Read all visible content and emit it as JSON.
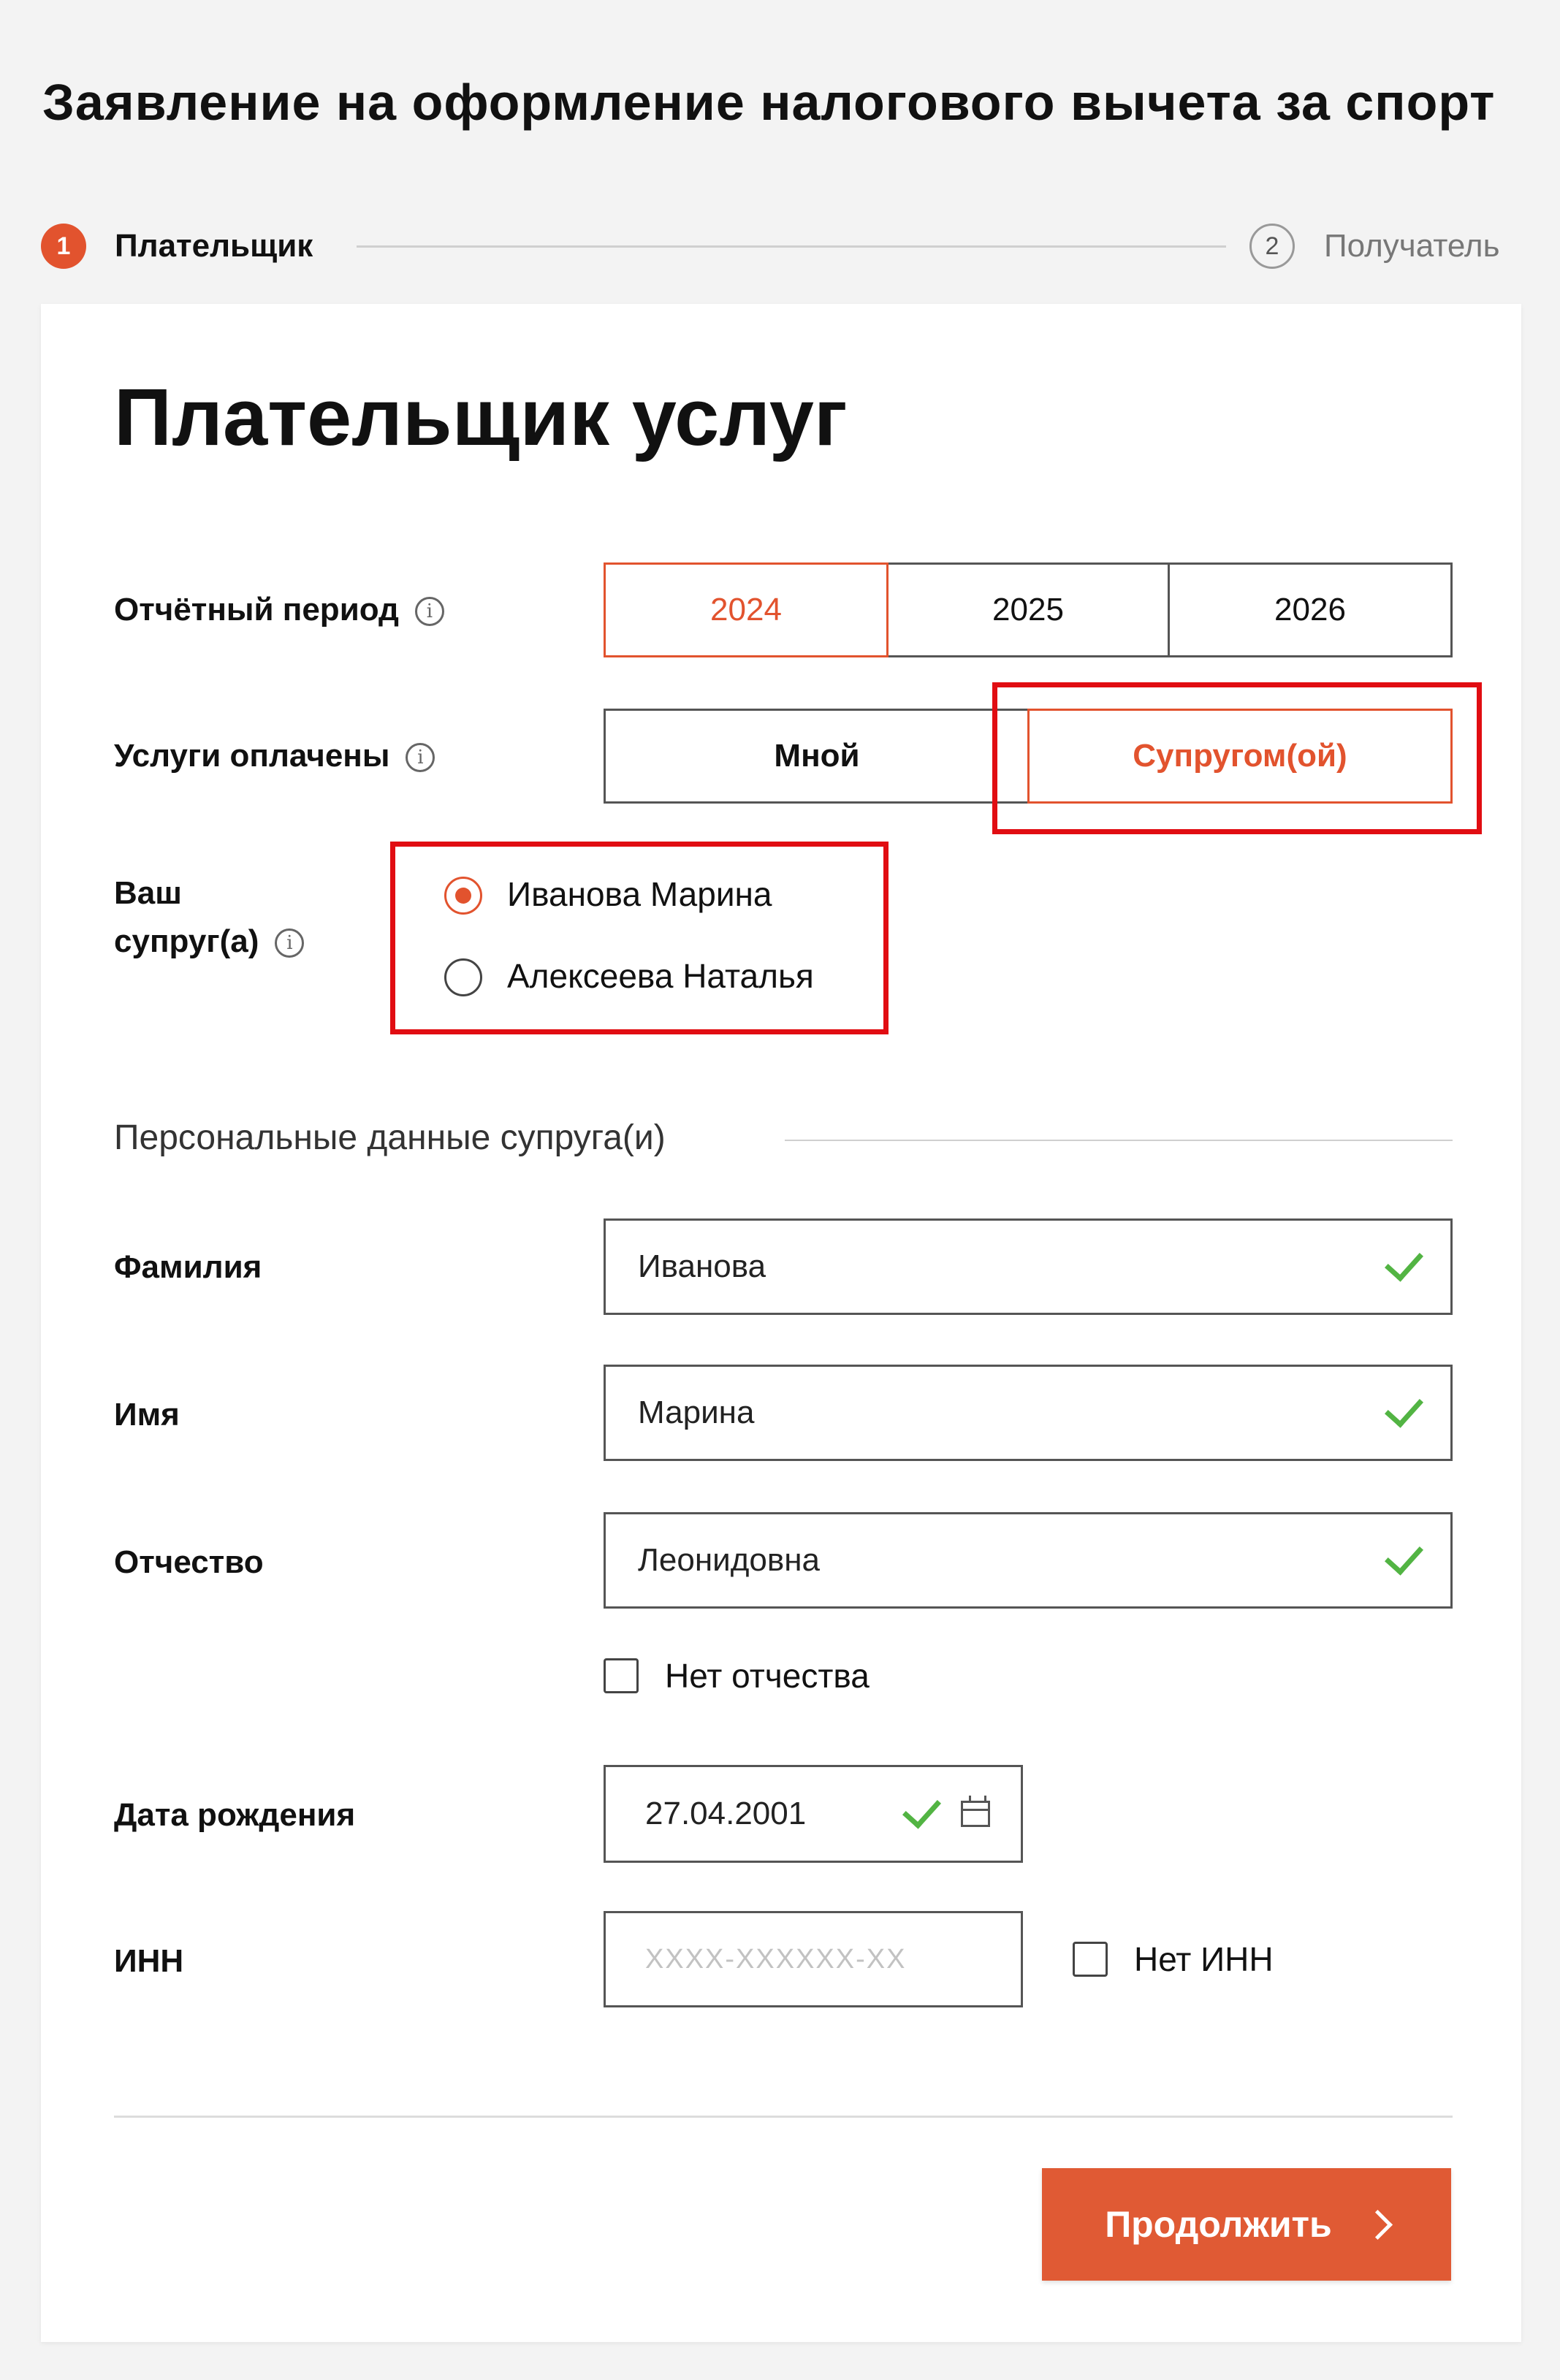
{
  "header": {
    "title": "Заявление на оформление налогового вычета за спорт"
  },
  "stepper": {
    "steps": [
      {
        "number": "1",
        "label": "Плательщик",
        "state": "active"
      },
      {
        "number": "2",
        "label": "Получатель",
        "state": "inactive"
      }
    ]
  },
  "form": {
    "title": "Плательщик услуг",
    "reporting_period": {
      "label": "Отчётный период",
      "options": [
        "2024",
        "2025",
        "2026"
      ],
      "selected": "2024"
    },
    "paid_by": {
      "label": "Услуги оплачены",
      "options": [
        "Мной",
        "Супругом(ой)"
      ],
      "selected": "Супругом(ой)"
    },
    "spouse": {
      "label_line1": "Ваш",
      "label_line2": "супруг(а)",
      "options": [
        "Иванова Марина",
        "Алексеева Наталья"
      ],
      "selected": "Иванова Марина"
    },
    "personal_section_title": "Персональные данные супруга(и)",
    "surname": {
      "label": "Фамилия",
      "value": "Иванова"
    },
    "name": {
      "label": "Имя",
      "value": "Марина"
    },
    "patronymic": {
      "label": "Отчество",
      "value": "Леонидовна"
    },
    "no_patronymic": {
      "label": "Нет отчества",
      "checked": false
    },
    "birth_date": {
      "label": "Дата рождения",
      "value": "27.04.2001"
    },
    "inn": {
      "label": "ИНН",
      "placeholder": "XXXX-XXXXXX-XX",
      "value": ""
    },
    "no_inn": {
      "label": "Нет ИНН",
      "checked": false
    },
    "continue_label": "Продолжить"
  },
  "colors": {
    "accent": "#e2532e",
    "highlight": "#e10d12",
    "valid": "#52b443",
    "background": "#f3f3f3"
  },
  "icons": [
    "info-icon",
    "check-icon",
    "calendar-icon",
    "chevron-right-icon"
  ]
}
